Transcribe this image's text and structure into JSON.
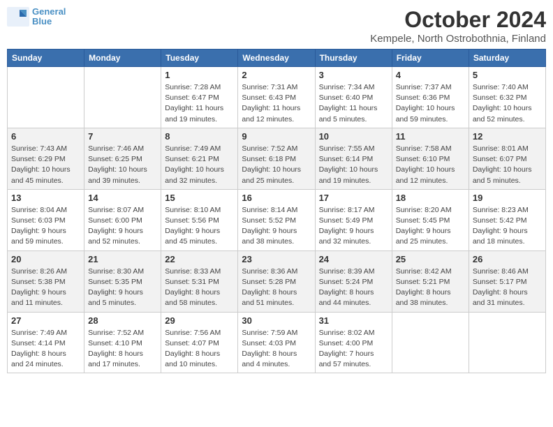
{
  "logo": {
    "line1": "General",
    "line2": "Blue"
  },
  "title": "October 2024",
  "subtitle": "Kempele, North Ostrobothnia, Finland",
  "headers": [
    "Sunday",
    "Monday",
    "Tuesday",
    "Wednesday",
    "Thursday",
    "Friday",
    "Saturday"
  ],
  "weeks": [
    [
      {
        "date": "",
        "info": ""
      },
      {
        "date": "",
        "info": ""
      },
      {
        "date": "1",
        "info": "Sunrise: 7:28 AM\nSunset: 6:47 PM\nDaylight: 11 hours and 19 minutes."
      },
      {
        "date": "2",
        "info": "Sunrise: 7:31 AM\nSunset: 6:43 PM\nDaylight: 11 hours and 12 minutes."
      },
      {
        "date": "3",
        "info": "Sunrise: 7:34 AM\nSunset: 6:40 PM\nDaylight: 11 hours and 5 minutes."
      },
      {
        "date": "4",
        "info": "Sunrise: 7:37 AM\nSunset: 6:36 PM\nDaylight: 10 hours and 59 minutes."
      },
      {
        "date": "5",
        "info": "Sunrise: 7:40 AM\nSunset: 6:32 PM\nDaylight: 10 hours and 52 minutes."
      }
    ],
    [
      {
        "date": "6",
        "info": "Sunrise: 7:43 AM\nSunset: 6:29 PM\nDaylight: 10 hours and 45 minutes."
      },
      {
        "date": "7",
        "info": "Sunrise: 7:46 AM\nSunset: 6:25 PM\nDaylight: 10 hours and 39 minutes."
      },
      {
        "date": "8",
        "info": "Sunrise: 7:49 AM\nSunset: 6:21 PM\nDaylight: 10 hours and 32 minutes."
      },
      {
        "date": "9",
        "info": "Sunrise: 7:52 AM\nSunset: 6:18 PM\nDaylight: 10 hours and 25 minutes."
      },
      {
        "date": "10",
        "info": "Sunrise: 7:55 AM\nSunset: 6:14 PM\nDaylight: 10 hours and 19 minutes."
      },
      {
        "date": "11",
        "info": "Sunrise: 7:58 AM\nSunset: 6:10 PM\nDaylight: 10 hours and 12 minutes."
      },
      {
        "date": "12",
        "info": "Sunrise: 8:01 AM\nSunset: 6:07 PM\nDaylight: 10 hours and 5 minutes."
      }
    ],
    [
      {
        "date": "13",
        "info": "Sunrise: 8:04 AM\nSunset: 6:03 PM\nDaylight: 9 hours and 59 minutes."
      },
      {
        "date": "14",
        "info": "Sunrise: 8:07 AM\nSunset: 6:00 PM\nDaylight: 9 hours and 52 minutes."
      },
      {
        "date": "15",
        "info": "Sunrise: 8:10 AM\nSunset: 5:56 PM\nDaylight: 9 hours and 45 minutes."
      },
      {
        "date": "16",
        "info": "Sunrise: 8:14 AM\nSunset: 5:52 PM\nDaylight: 9 hours and 38 minutes."
      },
      {
        "date": "17",
        "info": "Sunrise: 8:17 AM\nSunset: 5:49 PM\nDaylight: 9 hours and 32 minutes."
      },
      {
        "date": "18",
        "info": "Sunrise: 8:20 AM\nSunset: 5:45 PM\nDaylight: 9 hours and 25 minutes."
      },
      {
        "date": "19",
        "info": "Sunrise: 8:23 AM\nSunset: 5:42 PM\nDaylight: 9 hours and 18 minutes."
      }
    ],
    [
      {
        "date": "20",
        "info": "Sunrise: 8:26 AM\nSunset: 5:38 PM\nDaylight: 9 hours and 11 minutes."
      },
      {
        "date": "21",
        "info": "Sunrise: 8:30 AM\nSunset: 5:35 PM\nDaylight: 9 hours and 5 minutes."
      },
      {
        "date": "22",
        "info": "Sunrise: 8:33 AM\nSunset: 5:31 PM\nDaylight: 8 hours and 58 minutes."
      },
      {
        "date": "23",
        "info": "Sunrise: 8:36 AM\nSunset: 5:28 PM\nDaylight: 8 hours and 51 minutes."
      },
      {
        "date": "24",
        "info": "Sunrise: 8:39 AM\nSunset: 5:24 PM\nDaylight: 8 hours and 44 minutes."
      },
      {
        "date": "25",
        "info": "Sunrise: 8:42 AM\nSunset: 5:21 PM\nDaylight: 8 hours and 38 minutes."
      },
      {
        "date": "26",
        "info": "Sunrise: 8:46 AM\nSunset: 5:17 PM\nDaylight: 8 hours and 31 minutes."
      }
    ],
    [
      {
        "date": "27",
        "info": "Sunrise: 7:49 AM\nSunset: 4:14 PM\nDaylight: 8 hours and 24 minutes."
      },
      {
        "date": "28",
        "info": "Sunrise: 7:52 AM\nSunset: 4:10 PM\nDaylight: 8 hours and 17 minutes."
      },
      {
        "date": "29",
        "info": "Sunrise: 7:56 AM\nSunset: 4:07 PM\nDaylight: 8 hours and 10 minutes."
      },
      {
        "date": "30",
        "info": "Sunrise: 7:59 AM\nSunset: 4:03 PM\nDaylight: 8 hours and 4 minutes."
      },
      {
        "date": "31",
        "info": "Sunrise: 8:02 AM\nSunset: 4:00 PM\nDaylight: 7 hours and 57 minutes."
      },
      {
        "date": "",
        "info": ""
      },
      {
        "date": "",
        "info": ""
      }
    ]
  ]
}
